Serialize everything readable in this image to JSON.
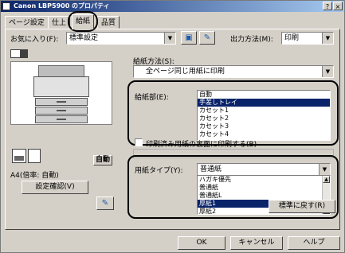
{
  "window": {
    "title": "Canon LBP5900 のプロパティ",
    "help_btn": "?",
    "close_btn": "×"
  },
  "tabs": [
    {
      "label": "ページ設定"
    },
    {
      "label": "仕上"
    },
    {
      "label": "給紙"
    },
    {
      "label": "品質"
    }
  ],
  "favorites": {
    "label": "お気に入り(F):",
    "value": "標準設定"
  },
  "output_method": {
    "label": "出力方法(M):",
    "value": "印刷"
  },
  "feed_method": {
    "label": "給紙方法(S):",
    "value": "全ページ同じ用紙に印刷"
  },
  "paper_source": {
    "label": "給紙部(E):",
    "options": [
      "自動",
      "手差しトレイ",
      "カセット1",
      "カセット2",
      "カセット3",
      "カセット4"
    ],
    "selected_index": 1
  },
  "back_side": {
    "label": "印刷済み用紙の裏面に印刷する(B)",
    "checked": false
  },
  "paper_type": {
    "label": "用紙タイプ(Y):",
    "value": "普通紙",
    "options": [
      "ハガキ優先",
      "普通紙",
      "普通紙L",
      "厚紙1",
      "厚紙2"
    ],
    "selected_index": 3
  },
  "preview": {
    "auto_label": "自動",
    "size_text": "A4(倍率: 自動)",
    "confirm_btn": "設定確認(V)"
  },
  "buttons": {
    "restore_defaults": "標準に戻す(R)",
    "ok": "OK",
    "cancel": "キャンセル",
    "help": "ヘルプ"
  },
  "highlight_color": "#000000"
}
